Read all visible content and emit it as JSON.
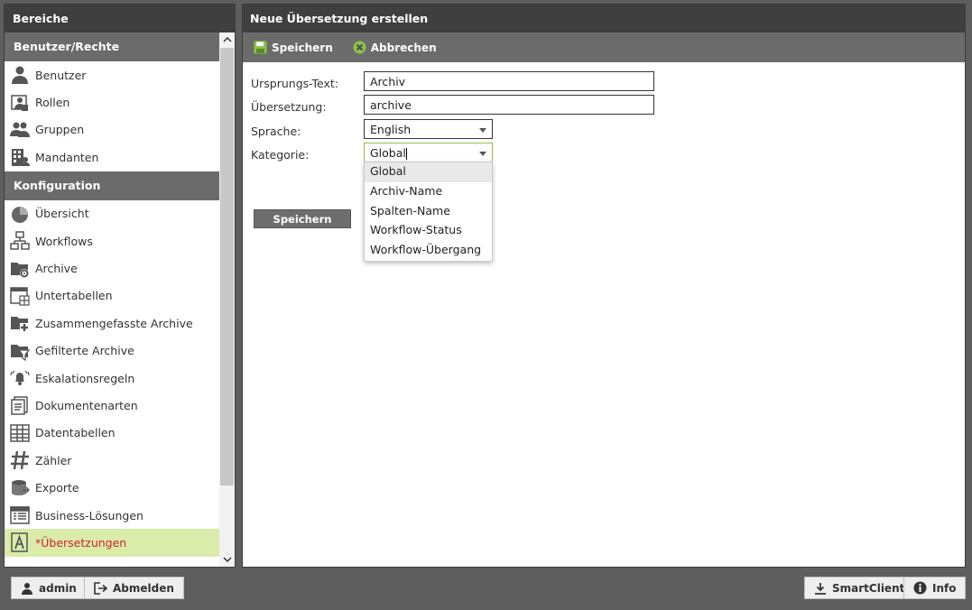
{
  "left": {
    "title": "Bereiche",
    "sections": [
      {
        "title": "Benutzer/Rechte",
        "items": [
          {
            "label": "Benutzer",
            "icon": "user-icon"
          },
          {
            "label": "Rollen",
            "icon": "roles-icon"
          },
          {
            "label": "Gruppen",
            "icon": "group-icon"
          },
          {
            "label": "Mandanten",
            "icon": "building-icon"
          }
        ]
      },
      {
        "title": "Konfiguration",
        "items": [
          {
            "label": "Übersicht",
            "icon": "pie-chart-icon"
          },
          {
            "label": "Workflows",
            "icon": "workflow-icon"
          },
          {
            "label": "Archive",
            "icon": "folder-gear-icon"
          },
          {
            "label": "Untertabellen",
            "icon": "subtable-icon"
          },
          {
            "label": "Zusammengefasste Archive",
            "icon": "folder-plus-icon"
          },
          {
            "label": "Gefilterte Archive",
            "icon": "folder-filter-icon"
          },
          {
            "label": "Eskalationsregeln",
            "icon": "bell-icon"
          },
          {
            "label": "Dokumentenarten",
            "icon": "document-types-icon"
          },
          {
            "label": "Datentabellen",
            "icon": "table-icon"
          },
          {
            "label": "Zähler",
            "icon": "hash-icon"
          },
          {
            "label": "Exporte",
            "icon": "export-icon"
          },
          {
            "label": "Business-Lösungen",
            "icon": "business-icon"
          },
          {
            "label": "*Übersetzungen",
            "icon": "translation-icon",
            "active": true
          }
        ]
      }
    ]
  },
  "main": {
    "title": "Neue Übersetzung erstellen",
    "toolbar": {
      "save_label": "Speichern",
      "cancel_label": "Abbrechen"
    },
    "form": {
      "source_label": "Ursprungs-Text:",
      "source_value": "Archiv",
      "translation_label": "Übersetzung:",
      "translation_value": "archive",
      "language_label": "Sprache:",
      "language_value": "English",
      "category_label": "Kategorie:",
      "category_value": "Global",
      "category_options": [
        "Global",
        "Archiv-Name",
        "Spalten-Name",
        "Workflow-Status",
        "Workflow-Übergang"
      ],
      "save_button": "Speichern"
    }
  },
  "footer": {
    "user_label": "admin",
    "logout_label": "Abmelden",
    "smartclient_label": "SmartClient",
    "info_label": "Info"
  },
  "colors": {
    "accent_green": "#8bc34a",
    "active_bg": "#d9ecaa",
    "active_text": "#d2222a"
  }
}
